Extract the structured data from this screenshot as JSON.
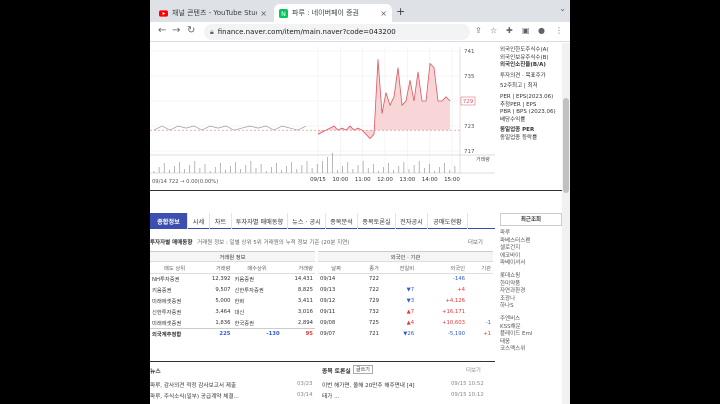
{
  "browser": {
    "tabs": [
      {
        "title": "채널 콘텐츠 - YouTube Studio"
      },
      {
        "title": "파루 : 네이버페이 증권"
      }
    ],
    "url": "finance.naver.com/item/main.naver?code=043200"
  },
  "chart_data": {
    "type": "line",
    "title": "",
    "xlabel": "",
    "ylabel": "",
    "x_ticks": [
      "09/15",
      "10:00",
      "11:00",
      "12:00",
      "13:00",
      "14:00",
      "15:00"
    ],
    "y_ticks": [
      741,
      735,
      729,
      723,
      717
    ],
    "ylim": [
      717,
      741
    ],
    "left_axis_label": "09/14  722 → 0.00(0.00%)",
    "volume_label": "거래량",
    "price_label": "729",
    "series": [
      {
        "values": [
          721,
          721.5,
          722,
          722.5,
          723,
          722,
          722.5,
          722,
          723,
          722,
          722.5,
          722,
          721,
          720,
          721,
          739,
          726,
          731,
          728,
          730,
          737,
          728,
          729,
          734,
          729,
          736,
          729,
          729,
          738,
          737,
          729,
          729,
          730,
          729
        ]
      }
    ]
  },
  "right_panel": {
    "items": [
      "외국인한도주식수(A)",
      "외국인보유주식수(B)",
      "외국인소진율(B/A)",
      "",
      "투자의견 · 목표주가",
      "",
      "52주최고 | 최저",
      "",
      "PER | EPS(2023.06)",
      "추정PER | EPS",
      "PBR | BPS (2023.06)",
      "배당수익률",
      "",
      "동일업종 PER",
      "동일업종 등락률"
    ]
  },
  "subtabs": [
    "종합정보",
    "시세",
    "차트",
    "투자자별 매매동향",
    "뉴스 · 공시",
    "종목분석",
    "종목토론실",
    "전자공시",
    "공매도현황"
  ],
  "section": {
    "title": "투자자별 매매동향",
    "desc": "거래원 정보 : 일별 상위 5위 거래원의 누적 정보 기준 (20분 지연)",
    "more": "더보기"
  },
  "broker": {
    "group_header": "거래원 정보",
    "headers": [
      "매도 상위",
      "거래량",
      "매수상위",
      "거래량"
    ],
    "rows": [
      [
        "NH투자증권",
        "12,392",
        "키움증권",
        "14,431"
      ],
      [
        "키움증권",
        "9,507",
        "신한투자증권",
        "8,825"
      ],
      [
        "미래에셋증권",
        "5,000",
        "한화",
        "3,411"
      ],
      [
        "신한투자증권",
        "3,464",
        "대신",
        "3,016"
      ],
      [
        "미래에셋증권",
        "1,836",
        "한국증권",
        "2,894"
      ]
    ],
    "sum": [
      "외국계추정합",
      "225",
      "-130",
      "95"
    ]
  },
  "foreign": {
    "group_header": "외국인 · 기관",
    "headers": [
      "날짜",
      "종가",
      "전일비",
      "외국인",
      "기관"
    ],
    "rows": [
      [
        "09/14",
        "722",
        "",
        "-146",
        ""
      ],
      [
        "09/13",
        "722",
        "▼7",
        "+4",
        ""
      ],
      [
        "09/12",
        "729",
        "▼3",
        "+4,126",
        ""
      ],
      [
        "09/11",
        "732",
        "▲7",
        "+16,171",
        ""
      ],
      [
        "09/08",
        "725",
        "▲4",
        "+10,603",
        "-1"
      ],
      [
        "09/07",
        "721",
        "▼26",
        "-5,190",
        "+1"
      ]
    ]
  },
  "news": {
    "left_header": "뉴스",
    "left_items": [
      {
        "text": "파루, 감사의견 적정 감사보고서 제출",
        "date": "03/23"
      },
      {
        "text": "파루, 주식소식(일부) 공급계약 체결...",
        "date": "03/14"
      }
    ],
    "right_header": "종목 토론실",
    "right_button": "글쓰기",
    "right_items": [
      {
        "text": "이번 해가면, 올해 20만주 해주면내 [4]",
        "date": "09/15 10:52"
      },
      {
        "text": "태가 ...",
        "date": "09/15 10:12"
      }
    ],
    "more": "더보기"
  },
  "recent": {
    "title": "최근조회",
    "groups": [
      [
        "파루",
        "파베스터스펜",
        "셀로건지",
        "에코바이",
        "파베이셔서"
      ],
      [
        "롯데쇼핑",
        "한미약품",
        "자연과환경",
        "조광나",
        "하나S"
      ],
      [
        "주엔비스",
        "KSS해운",
        "플레이드 Eml",
        "태웅",
        "코스맥스위"
      ]
    ]
  }
}
